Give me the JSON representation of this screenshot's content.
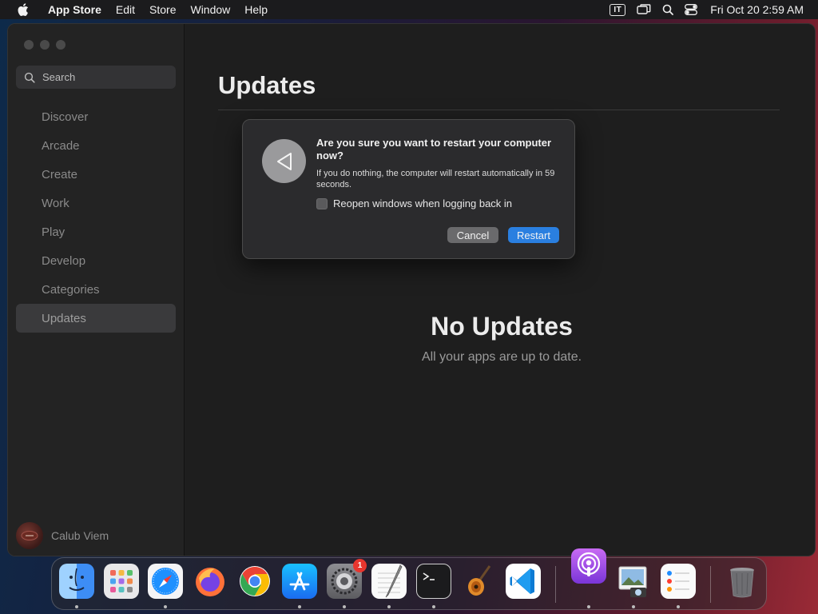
{
  "menubar": {
    "app_name": "App Store",
    "menus": [
      "Edit",
      "Store",
      "Window",
      "Help"
    ],
    "input_source": "IT",
    "clock": "Fri Oct 20  2:59 AM"
  },
  "sidebar": {
    "search_placeholder": "Search",
    "items": [
      {
        "label": "Discover"
      },
      {
        "label": "Arcade"
      },
      {
        "label": "Create"
      },
      {
        "label": "Work"
      },
      {
        "label": "Play"
      },
      {
        "label": "Develop"
      },
      {
        "label": "Categories"
      },
      {
        "label": "Updates",
        "active": true
      }
    ],
    "user_name": "Calub Viem"
  },
  "main": {
    "title": "Updates",
    "empty_title": "No Updates",
    "empty_subtitle": "All your apps are up to date."
  },
  "dialog": {
    "title": "Are you sure you want to restart your computer now?",
    "message": "If you do nothing, the computer will restart automatically in 59 seconds.",
    "checkbox_label": "Reopen windows when logging back in",
    "checkbox_checked": false,
    "cancel_label": "Cancel",
    "restart_label": "Restart"
  },
  "dock": {
    "apps": [
      {
        "name": "Finder",
        "icon": "finder-icon",
        "running": true
      },
      {
        "name": "Launchpad",
        "icon": "launchpad-icon",
        "running": false
      },
      {
        "name": "Safari",
        "icon": "safari-icon",
        "running": true
      },
      {
        "name": "Firefox",
        "icon": "firefox-icon",
        "running": false
      },
      {
        "name": "Chrome",
        "icon": "chrome-icon",
        "running": false
      },
      {
        "name": "App Store",
        "icon": "app-store-icon",
        "running": true
      },
      {
        "name": "System Settings",
        "icon": "system-settings-icon",
        "running": true,
        "badge": "1"
      },
      {
        "name": "TextEdit",
        "icon": "textedit-icon",
        "running": true
      },
      {
        "name": "Terminal",
        "icon": "terminal-icon",
        "running": true
      },
      {
        "name": "GarageBand",
        "icon": "garageband-icon",
        "running": false
      },
      {
        "name": "Visual Studio Code",
        "icon": "vscode-icon",
        "running": false
      },
      {
        "name": "Podcasts",
        "icon": "podcasts-icon",
        "running": true
      },
      {
        "name": "Preview",
        "icon": "preview-icon",
        "running": true
      },
      {
        "name": "Reminders",
        "icon": "reminders-icon",
        "running": true
      },
      {
        "name": "Trash",
        "icon": "trash-icon",
        "running": false
      }
    ],
    "colors": {
      "finder": "#3d8df5",
      "safari": "#1e90ff",
      "app_store": "#1a8cff",
      "vscode": "#0d7bd4",
      "podcasts": "#9b4ce0"
    }
  }
}
